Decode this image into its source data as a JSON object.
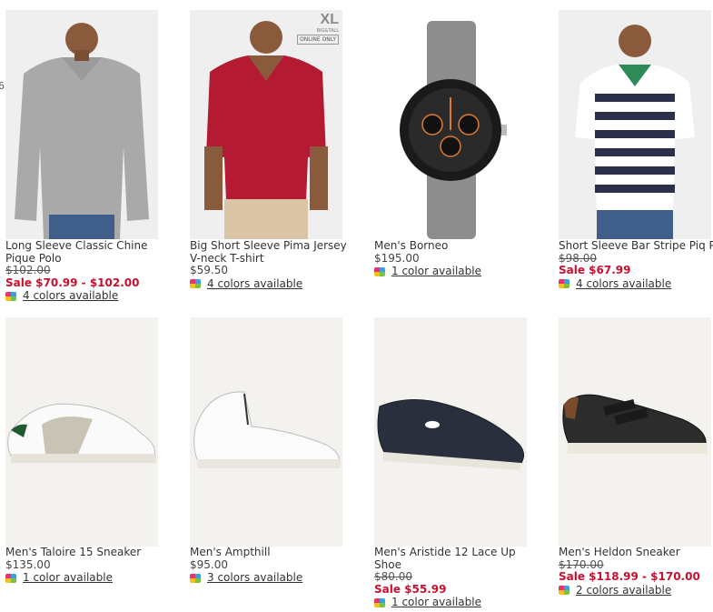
{
  "edge_fragment": "6",
  "products": [
    {
      "name": "Long Sleeve Classic Chine\nPique Polo",
      "original_price": "$102.00",
      "sale_price": "Sale $70.99 - $102.00",
      "colors_link": "4 colors available",
      "badge": null
    },
    {
      "name": "Big Short Sleeve Pima Jersey\nV-neck T-shirt",
      "price": "$59.50",
      "colors_link": "4 colors available",
      "badge": {
        "size": "XL",
        "sub": "BIG&TALL",
        "note": "ONLINE ONLY"
      }
    },
    {
      "name": "Men's Borneo",
      "price": "$195.00",
      "colors_link": "1 color available",
      "badge": null
    },
    {
      "name": "Short Sleeve Bar Stripe Piq\nPolo Multi Color Collar",
      "original_price": "$98.00",
      "sale_price": "Sale $67.99",
      "colors_link": "4 colors available",
      "badge": null
    },
    {
      "name": "Men's Taloire 15 Sneaker",
      "price": "$135.00",
      "colors_link": "1 color available",
      "badge": null
    },
    {
      "name": "Men's Ampthill",
      "price": "$95.00",
      "colors_link": "3 colors available",
      "badge": null
    },
    {
      "name": "Men's Aristide 12 Lace Up\nShoe",
      "original_price": "$80.00",
      "sale_price": "Sale $55.99",
      "colors_link": "1 color available",
      "badge": null
    },
    {
      "name": "Men's Heldon Sneaker",
      "original_price": "$170.00",
      "sale_price": "Sale $118.99 - $170.00",
      "colors_link": "2 colors available",
      "badge": null
    }
  ],
  "colors": {
    "sale": "#c8102e",
    "swatch": [
      "#e8336d",
      "#3aa0e6",
      "#f6c11b",
      "#7ac143"
    ]
  },
  "icons": {
    "swatch": "color-swatch-icon"
  }
}
